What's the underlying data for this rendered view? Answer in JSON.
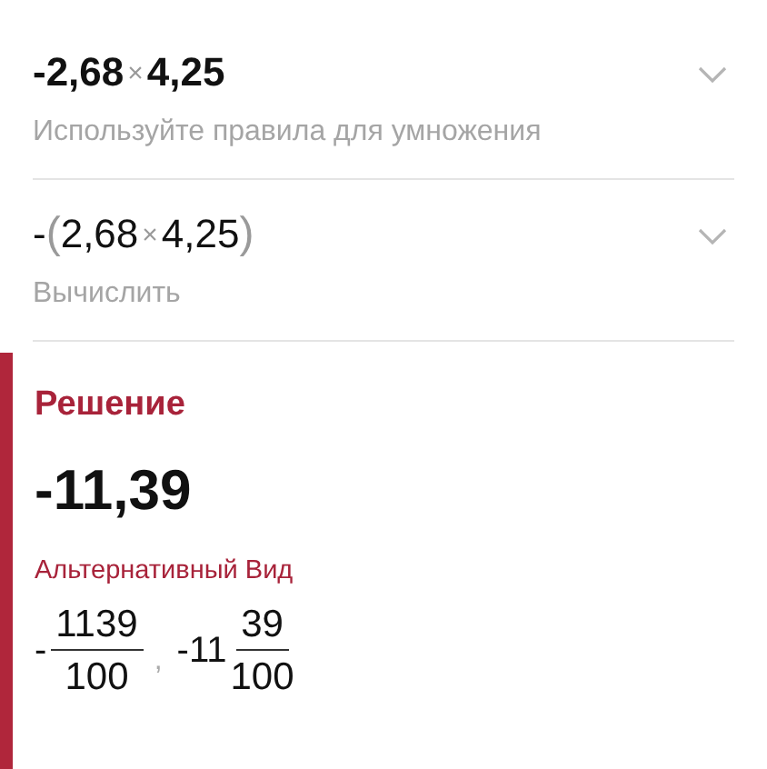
{
  "steps": [
    {
      "bold": true,
      "expression": [
        {
          "kind": "num",
          "text": "-2,68"
        },
        {
          "kind": "op",
          "text": "×"
        },
        {
          "kind": "num",
          "text": "4,25"
        }
      ],
      "hint": "Используйте правила для умножения"
    },
    {
      "bold": false,
      "expression": [
        {
          "kind": "num",
          "text": "-"
        },
        {
          "kind": "paren",
          "text": "("
        },
        {
          "kind": "num",
          "text": "2,68"
        },
        {
          "kind": "op",
          "text": "×"
        },
        {
          "kind": "num",
          "text": "4,25"
        },
        {
          "kind": "paren",
          "text": ")"
        }
      ],
      "hint": "Вычислить"
    }
  ],
  "solution": {
    "title": "Решение",
    "result": "-11,39",
    "alt_title": "Альтернативный Вид",
    "separator": ",",
    "alternatives": [
      {
        "kind": "fraction",
        "sign": "-",
        "numerator": "1139",
        "denominator": "100"
      },
      {
        "kind": "mixed",
        "sign": "-",
        "whole": "11",
        "numerator": "39",
        "denominator": "100"
      }
    ]
  }
}
